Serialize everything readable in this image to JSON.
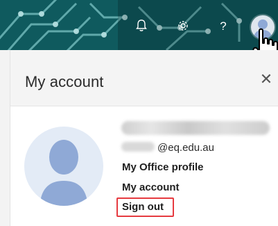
{
  "header": {
    "icons": [
      "bell-icon",
      "gear-icon",
      "help-icon"
    ],
    "help_glyph": "?"
  },
  "panel": {
    "title": "My account",
    "close_glyph": "✕",
    "email_suffix": "@eq.edu.au",
    "links": [
      {
        "label": "My Office profile"
      },
      {
        "label": "My account"
      },
      {
        "label": "Sign out"
      }
    ]
  },
  "colors": {
    "banner": "#0f5a5e",
    "highlight": "#e63a40",
    "avatar_fill": "#8fa9d6"
  }
}
